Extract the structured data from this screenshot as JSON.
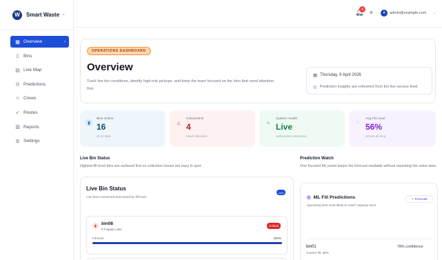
{
  "app": {
    "logo_letter": "W",
    "name": "Smart Waste",
    "collapse_icon": "chevron-left-icon"
  },
  "sidebar": {
    "items": [
      {
        "label": "Overview",
        "icon": "grid-icon",
        "glyph": "▦",
        "active": true
      },
      {
        "label": "Bins",
        "icon": "trash-icon",
        "glyph": "🗑",
        "active": false
      },
      {
        "label": "Live Map",
        "icon": "map-icon",
        "glyph": "▤",
        "active": false
      },
      {
        "label": "Predictions",
        "icon": "target-icon",
        "glyph": "◎",
        "active": false
      },
      {
        "label": "Crews",
        "icon": "users-icon",
        "glyph": "☺",
        "active": false
      },
      {
        "label": "Routes",
        "icon": "navigation-icon",
        "glyph": "➶",
        "active": false
      },
      {
        "label": "Reports",
        "icon": "bar-chart-icon",
        "glyph": "▥",
        "active": false
      },
      {
        "label": "Settings",
        "icon": "gear-icon",
        "glyph": "⚙",
        "active": false
      }
    ]
  },
  "topbar": {
    "notification_count": "4",
    "avatar_letter": "A",
    "user_email": "admin@example.com"
  },
  "hero": {
    "badge": "OPERATIONS DASHBOARD",
    "title": "Overview",
    "subtitle": "Track live bin conditions, identify high-risk pickups, and keep the team focused on the bins that need attention first.",
    "date": "Thursday, 9 April 2026",
    "note": "Prediction insights are refreshed from the live service feed."
  },
  "stats": {
    "online": {
      "label": "Bins Online",
      "value": "16",
      "hint": "of 16 total"
    },
    "critical": {
      "label": "Critical Bins",
      "value": "4",
      "hint": "need collection"
    },
    "health": {
      "label": "System Health",
      "value": "Live",
      "hint": "websocket connected"
    },
    "fill": {
      "label": "Avg Fill Level",
      "value": "56%",
      "hint": "across all bins"
    }
  },
  "live_section": {
    "title": "Live Bin Status",
    "subtitle": "Highest fill-level bins are surfaced first so collection issues are easy to spot."
  },
  "prediction_section": {
    "title": "Prediction Watch",
    "subtitle": "One focused ML panel keeps the forecast readable without repeating the same data."
  },
  "live_panel": {
    "title": "Live Bin Status",
    "subtitle": "Live feed connected and sorted by fill level.",
    "badge": "Live",
    "bin": {
      "name": "bin08",
      "location": "9 Fulgata Lake",
      "status": "Critical",
      "fill_label": "Fill level",
      "fill_value": "100%",
      "fill_fraction": 1.0
    }
  },
  "ml_panel": {
    "title": "ML Fill Predictions",
    "subtitle": "Upcoming bins most likely to reach capacity soon",
    "forecast_label": "Forecast",
    "prediction": {
      "name": "bin01",
      "current": "Current fill: 38%",
      "confidence": "78% confidence"
    }
  },
  "colors": {
    "accent": "#1d4ed8",
    "critical": "#dc2626",
    "health": "#16a34a",
    "fill": "#7e22ce",
    "badge": "#fed7aa"
  }
}
